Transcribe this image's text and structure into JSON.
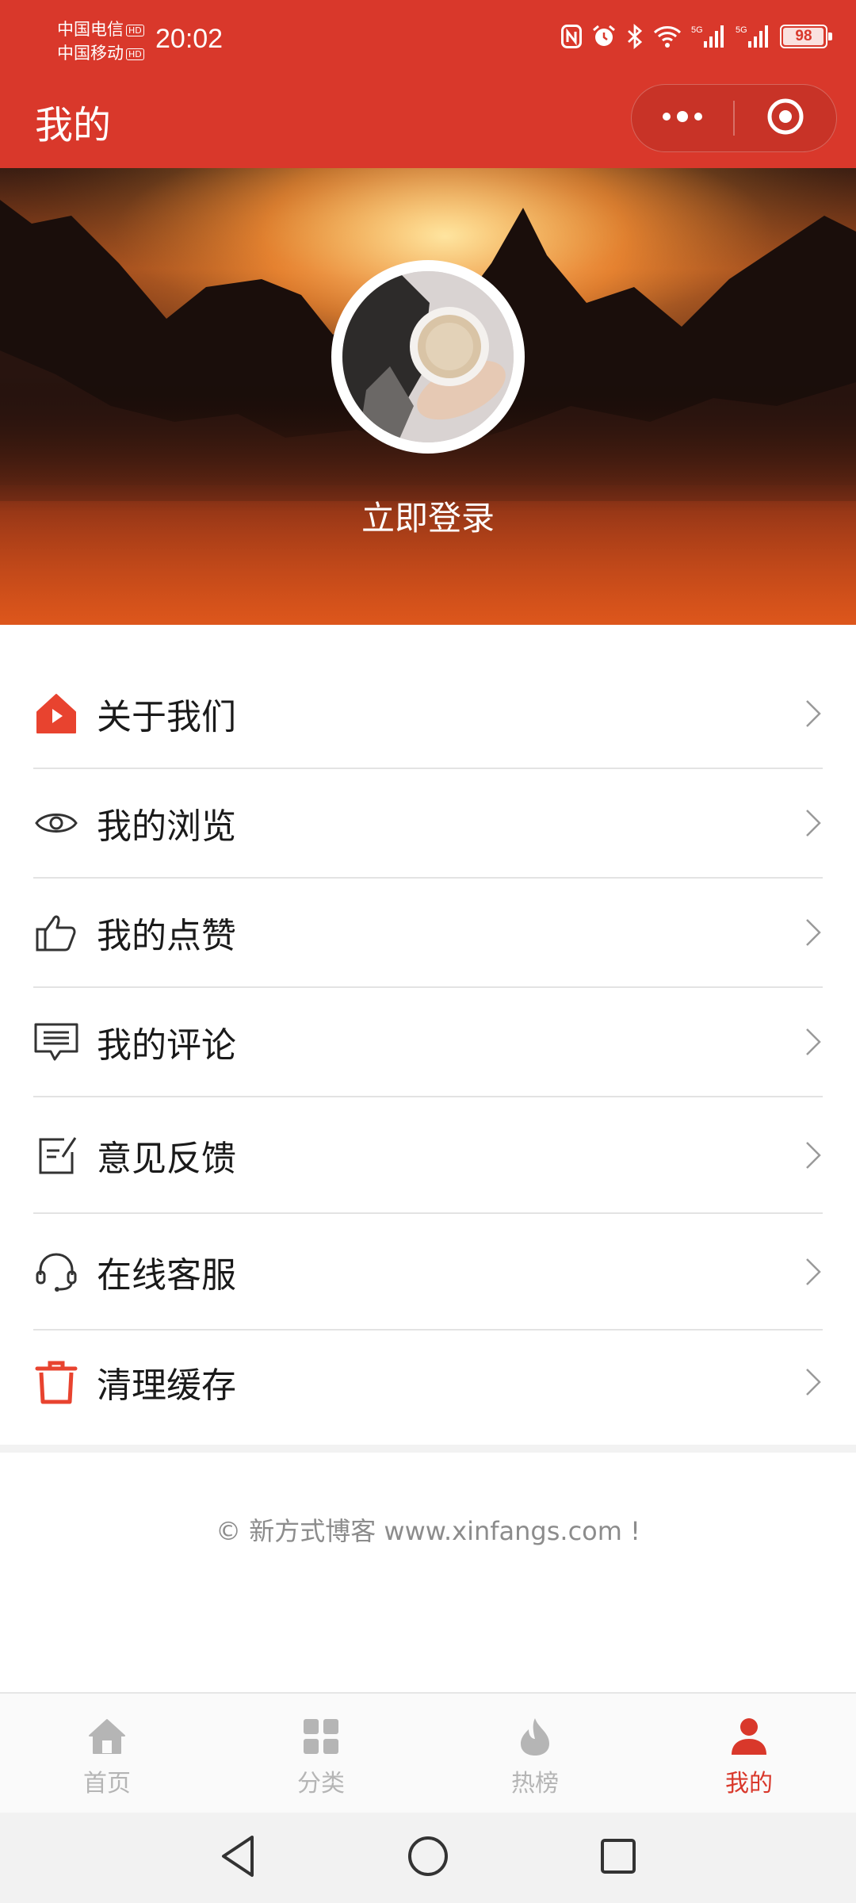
{
  "status_bar": {
    "carrier_1": "中国电信",
    "carrier_2": "中国移动",
    "hd_badge": "HD",
    "time": "20:02",
    "network_1": "5G",
    "network_2": "5G",
    "battery_percent": "98",
    "battery_level": 0.98,
    "icons": [
      "nfc-icon",
      "alarm-icon",
      "bluetooth-icon",
      "wifi-icon",
      "signal-icon",
      "signal-icon",
      "battery-icon"
    ]
  },
  "header": {
    "title": "我的",
    "capsule_icons": [
      "more-dots-icon",
      "close-target-icon"
    ]
  },
  "profile": {
    "login_label": "立即登录"
  },
  "menu": {
    "items": [
      {
        "label": "关于我们",
        "icon": "home-play-icon"
      },
      {
        "label": "我的浏览",
        "icon": "eye-icon"
      },
      {
        "label": "我的点赞",
        "icon": "thumbs-up-icon"
      },
      {
        "label": "我的评论",
        "icon": "comment-icon"
      },
      {
        "label": "意见反馈",
        "icon": "feedback-edit-icon"
      },
      {
        "label": "在线客服",
        "icon": "headset-icon"
      },
      {
        "label": "清理缓存",
        "icon": "trash-icon"
      }
    ]
  },
  "footer": {
    "copyright": "© 新方式博客 www.xinfangs.com !"
  },
  "tabbar": {
    "tabs": [
      {
        "label": "首页",
        "icon": "home-icon",
        "active": false
      },
      {
        "label": "分类",
        "icon": "grid-icon",
        "active": false
      },
      {
        "label": "热榜",
        "icon": "flame-icon",
        "active": false
      },
      {
        "label": "我的",
        "icon": "user-icon",
        "active": true
      }
    ]
  },
  "colors": {
    "brand": "#d9382b",
    "inactive_tab": "#b5b5b5",
    "divider": "#e3e3e3"
  }
}
